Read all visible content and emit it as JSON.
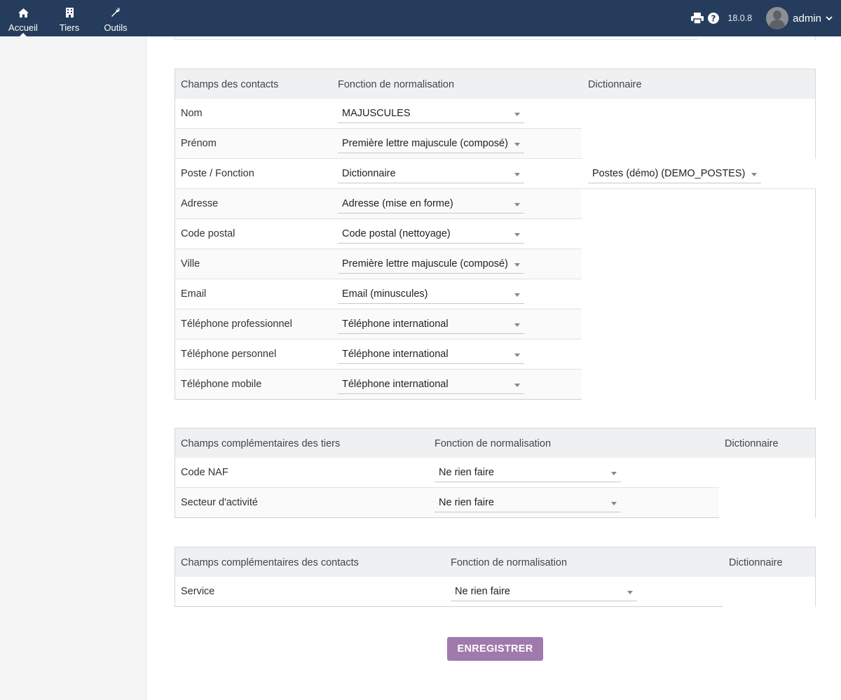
{
  "topbar": {
    "nav": [
      {
        "label": "Accueil",
        "icon": "home-icon"
      },
      {
        "label": "Tiers",
        "icon": "building-icon"
      },
      {
        "label": "Outils",
        "icon": "wrench-icon"
      }
    ],
    "version": "18.0.8",
    "user": "admin"
  },
  "contacts_table": {
    "headers": [
      "Champs des contacts",
      "Fonction de normalisation",
      "Dictionnaire"
    ],
    "rows": [
      {
        "field": "Nom",
        "function": "MAJUSCULES"
      },
      {
        "field": "Prénom",
        "function": "Première lettre majuscule (composé)"
      },
      {
        "field": "Poste / Fonction",
        "function": "Dictionnaire",
        "dictionary": "Postes (démo) (DEMO_POSTES)"
      },
      {
        "field": "Adresse",
        "function": "Adresse (mise en forme)"
      },
      {
        "field": "Code postal",
        "function": "Code postal (nettoyage)"
      },
      {
        "field": "Ville",
        "function": "Première lettre majuscule (composé)"
      },
      {
        "field": "Email",
        "function": "Email (minuscules)"
      },
      {
        "field": "Téléphone professionnel",
        "function": "Téléphone international"
      },
      {
        "field": "Téléphone personnel",
        "function": "Téléphone international"
      },
      {
        "field": "Téléphone mobile",
        "function": "Téléphone international"
      }
    ]
  },
  "tiers_extra_table": {
    "headers": [
      "Champs complémentaires des tiers",
      "Fonction de normalisation",
      "Dictionnaire"
    ],
    "rows": [
      {
        "field": "Code NAF",
        "function": "Ne rien faire"
      },
      {
        "field": "Secteur d'activité",
        "function": "Ne rien faire"
      }
    ]
  },
  "contacts_extra_table": {
    "headers": [
      "Champs complémentaires des contacts",
      "Fonction de normalisation",
      "Dictionnaire"
    ],
    "rows": [
      {
        "field": "Service",
        "function": "Ne rien faire"
      }
    ]
  },
  "save_label": "ENREGISTRER"
}
